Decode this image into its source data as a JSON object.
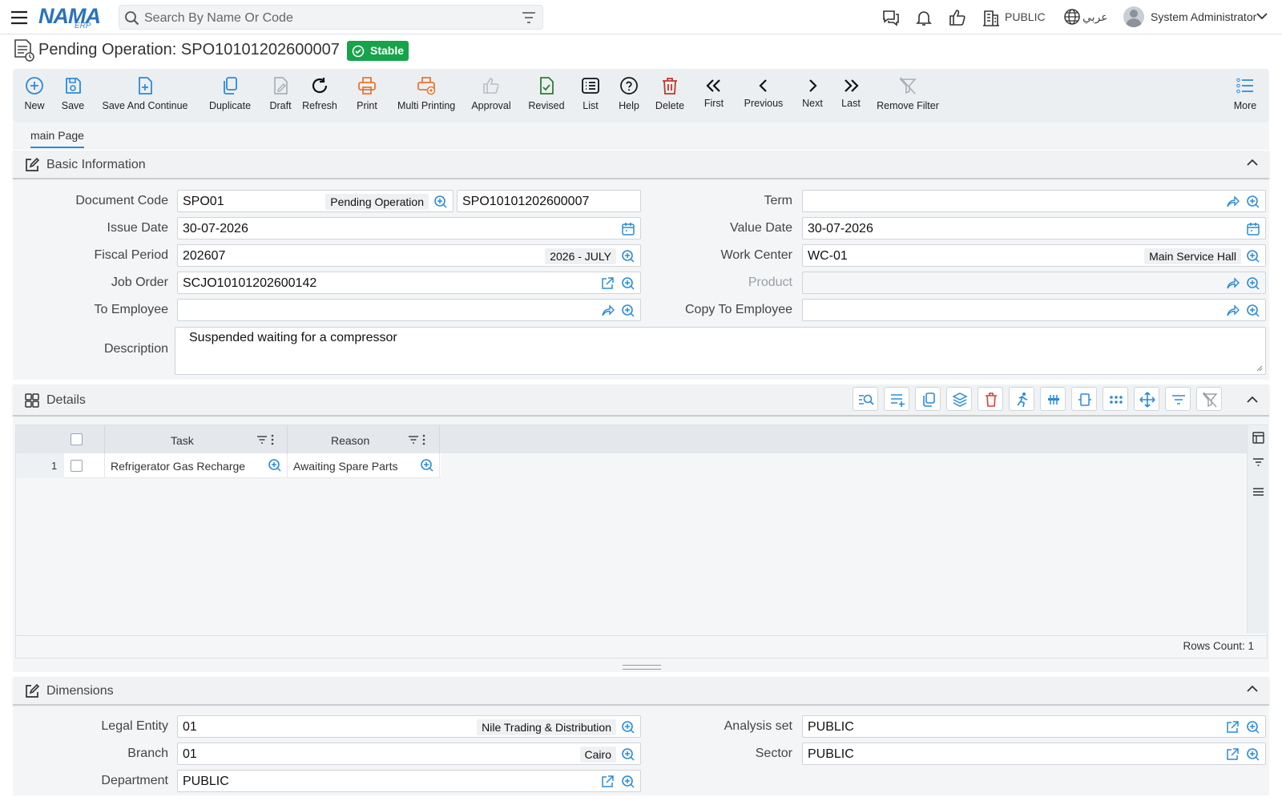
{
  "topbar": {
    "logo_main": "NAMA",
    "logo_sub": "ERP",
    "search_placeholder": "Search By Name Or Code",
    "company": "PUBLIC",
    "language": "عربي",
    "user": "System Administrator"
  },
  "page": {
    "title": "Pending Operation: SPO10101202600007",
    "status": "Stable"
  },
  "toolbar": {
    "new": "New",
    "save": "Save",
    "save_continue": "Save And Continue",
    "duplicate": "Duplicate",
    "draft": "Draft",
    "refresh": "Refresh",
    "print": "Print",
    "multi_printing": "Multi Printing",
    "approval": "Approval",
    "revised": "Revised",
    "list": "List",
    "help": "Help",
    "delete": "Delete",
    "first": "First",
    "previous": "Previous",
    "next": "Next",
    "last": "Last",
    "remove_filter": "Remove Filter",
    "more": "More"
  },
  "tabs": {
    "main": "main Page"
  },
  "basic": {
    "title": "Basic Information",
    "document_code_label": "Document Code",
    "document_code": "SPO01",
    "document_code_tag": "Pending Operation",
    "document_number": "SPO10101202600007",
    "term_label": "Term",
    "term": "",
    "issue_date_label": "Issue Date",
    "issue_date": "30-07-2026",
    "value_date_label": "Value Date",
    "value_date": "30-07-2026",
    "fiscal_period_label": "Fiscal Period",
    "fiscal_period": "202607",
    "fiscal_period_tag": "2026 - JULY",
    "work_center_label": "Work Center",
    "work_center": "WC-01",
    "work_center_tag": "Main Service Hall",
    "job_order_label": "Job Order",
    "job_order": "SCJO10101202600142",
    "product_label": "Product",
    "product": "",
    "to_employee_label": "To Employee",
    "to_employee": "",
    "copy_to_employee_label": "Copy To Employee",
    "copy_to_employee": "",
    "description_label": "Description",
    "description": "Suspended waiting for a compressor"
  },
  "details": {
    "title": "Details",
    "columns": [
      "Task",
      "Reason"
    ],
    "rows": [
      {
        "num": "1",
        "task": "Refrigerator Gas Recharge",
        "reason": "Awaiting Spare Parts"
      }
    ],
    "rows_count": "Rows Count: 1"
  },
  "dimensions": {
    "title": "Dimensions",
    "legal_entity_label": "Legal Entity",
    "legal_entity": "01",
    "legal_entity_tag": "Nile Trading & Distribution",
    "analysis_set_label": "Analysis set",
    "analysis_set": "PUBLIC",
    "branch_label": "Branch",
    "branch": "01",
    "branch_tag": "Cairo",
    "sector_label": "Sector",
    "sector": "PUBLIC",
    "department_label": "Department",
    "department": "PUBLIC"
  },
  "colors": {
    "accent": "#2a8bd8",
    "status_green": "#16a34a",
    "print_orange": "#e8772e",
    "delete_red": "#c0392b",
    "approve_gray": "#b9bec3",
    "revise_green": "#2e7d32"
  }
}
